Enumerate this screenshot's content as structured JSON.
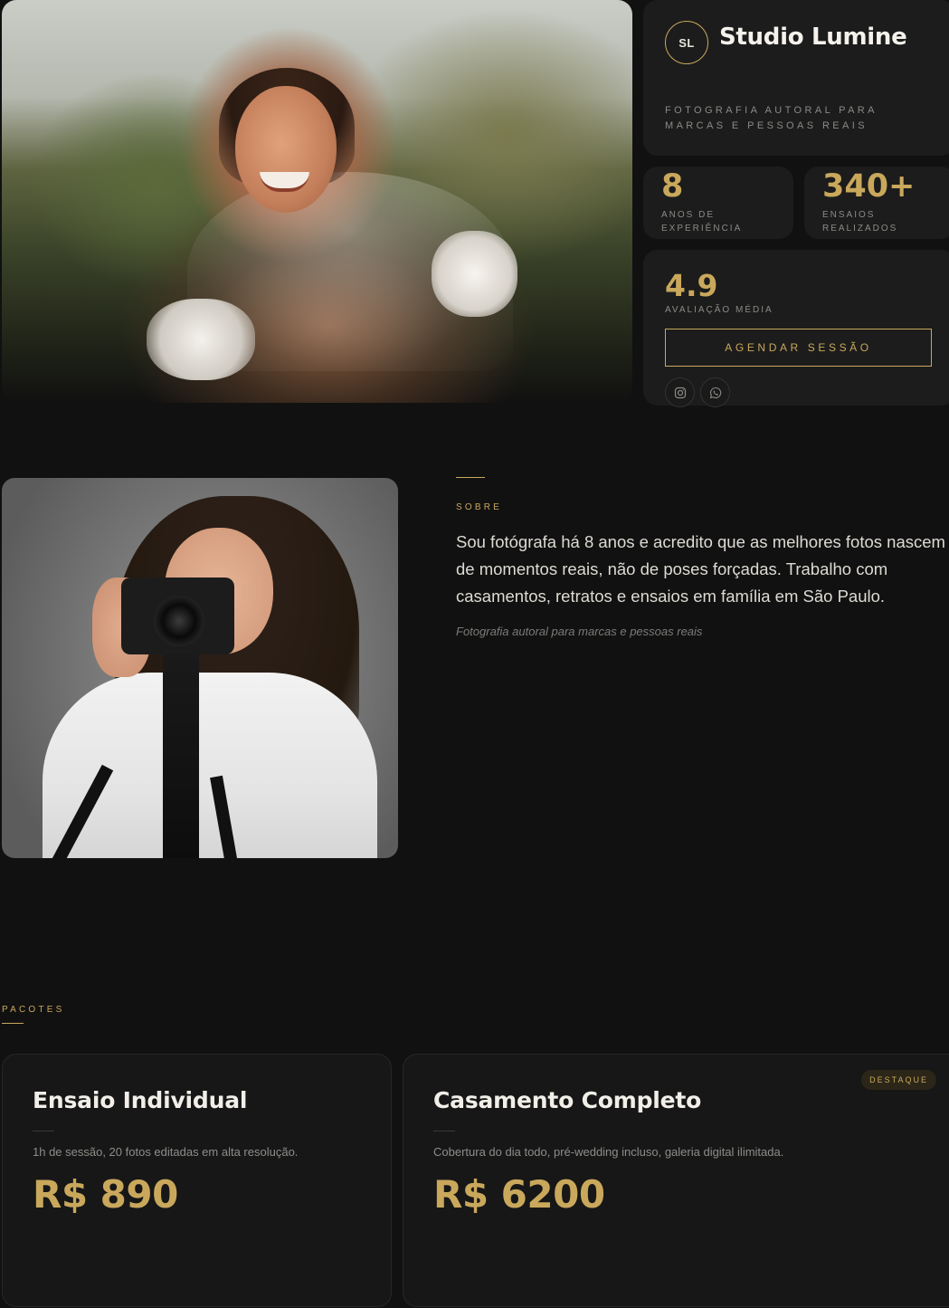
{
  "profile": {
    "initials": "SL",
    "name": "Studio Lumine",
    "tagline": "Fotografia autoral para marcas e pessoas reais"
  },
  "stats": [
    {
      "value": "8",
      "label": "Anos de experiência"
    },
    {
      "value": "340+",
      "label": "Ensaios realizados"
    }
  ],
  "rating": {
    "value": "4.9",
    "label": "Avaliação média",
    "cta_label": "Agendar sessão"
  },
  "social": [
    {
      "icon": "instagram-icon"
    },
    {
      "icon": "whatsapp-icon"
    }
  ],
  "about": {
    "eyebrow": "Sobre",
    "text": "Sou fotógrafa há 8 anos e acredito que as melhores fotos nascem de momentos reais, não de poses forçadas. Trabalho com casamentos, retratos e ensaios em família em São Paulo.",
    "quote": "Fotografia autoral para marcas e pessoas reais"
  },
  "packages": {
    "eyebrow": "Pacotes",
    "items": [
      {
        "name": "Ensaio Individual",
        "description": "1h de sessão, 20 fotos editadas em alta resolução.",
        "price": "R$ 890"
      },
      {
        "name": "Casamento Completo",
        "description": "Cobertura do dia todo, pré-wedding incluso, galeria digital ilimitada.",
        "price": "R$ 6200",
        "badge": "Destaque"
      }
    ]
  },
  "colors": {
    "background": "#111111",
    "card": "#1c1c1c",
    "accent_gold": "#c9a85c",
    "muted_text": "#8b8a86"
  }
}
